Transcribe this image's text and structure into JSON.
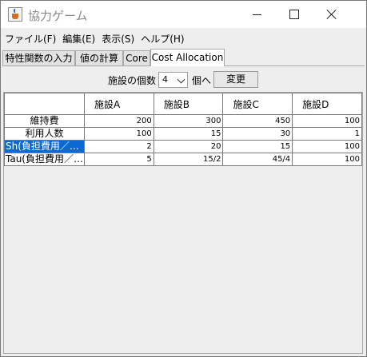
{
  "window": {
    "title": "協力ゲーム",
    "icon": "java-cup-icon"
  },
  "menu": [
    {
      "label": "ファイル(F)"
    },
    {
      "label": "編集(E)"
    },
    {
      "label": "表示(S)"
    },
    {
      "label": "ヘルプ(H)"
    }
  ],
  "tabs": [
    {
      "label": "特性関数の入力"
    },
    {
      "label": "値の計算"
    },
    {
      "label": "Core"
    },
    {
      "label": "Cost Allocation",
      "active": true
    }
  ],
  "controls": {
    "count_label": "施設の個数",
    "count_value": "4",
    "unit_label": "個へ",
    "change_button": "変更"
  },
  "table": {
    "columns": [
      "",
      "施設A",
      "施設B",
      "施設C",
      "施設D"
    ],
    "rows": [
      {
        "label": "維持費",
        "values": [
          "200",
          "300",
          "450",
          "100"
        ]
      },
      {
        "label": "利用人数",
        "values": [
          "100",
          "15",
          "30",
          "1"
        ]
      },
      {
        "label": "Sh(負担費用／…",
        "values": [
          "2",
          "20",
          "15",
          "100"
        ],
        "selected": true
      },
      {
        "label": "Tau(負担費用／…",
        "values": [
          "5",
          "15/2",
          "45/4",
          "100"
        ]
      }
    ]
  },
  "colors": {
    "selection": "#0a6ad2",
    "window_bg": "#eeeeee"
  }
}
